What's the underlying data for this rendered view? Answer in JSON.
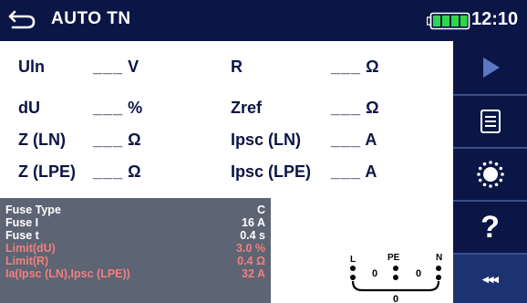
{
  "header": {
    "title": "AUTO TN",
    "time": "12:10",
    "back_icon": "back-arrow-icon",
    "battery_icon": "battery-icon"
  },
  "results": {
    "uln": {
      "label": "Uln",
      "value": "___",
      "unit": "V"
    },
    "du": {
      "label": "dU",
      "value": "___",
      "unit": "%"
    },
    "z_ln": {
      "label": "Z (LN)",
      "value": "___",
      "unit": "Ω"
    },
    "z_lpe": {
      "label": "Z (LPE)",
      "value": "___",
      "unit": "Ω"
    },
    "r": {
      "label": "R",
      "value": "___",
      "unit": "Ω"
    },
    "zref": {
      "label": "Zref",
      "value": "___",
      "unit": "Ω"
    },
    "ipsc_ln": {
      "label": "Ipsc (LN)",
      "value": "___",
      "unit": "A"
    },
    "ipsc_lpe": {
      "label": "Ipsc (LPE)",
      "value": "___",
      "unit": "A"
    }
  },
  "fuse": {
    "rows": [
      {
        "label": "Fuse Type",
        "value": "C",
        "style": "normal"
      },
      {
        "label": "Fuse I",
        "value": "16 A",
        "style": "normal"
      },
      {
        "label": "Fuse t",
        "value": "0.4 s",
        "style": "normal"
      },
      {
        "label": "Limit(dU)",
        "value": "3.0 %",
        "style": "limit"
      },
      {
        "label": "Limit(R)",
        "value": "0.4 Ω",
        "style": "limit"
      },
      {
        "label": "Ia(Ipsc (LN),Ipsc (LPE))",
        "value": "32 A",
        "style": "limit"
      }
    ]
  },
  "terminals": {
    "l_label": "L",
    "pe_label": "PE",
    "n_label": "N",
    "v1": "0",
    "v2": "0",
    "v3": "0"
  },
  "sidebar": {
    "buttons": [
      {
        "name": "start-button",
        "icon": "play-icon",
        "enabled": false
      },
      {
        "name": "parameters-button",
        "icon": "list-icon",
        "enabled": true
      },
      {
        "name": "calibration-button",
        "icon": "circle-dots-icon",
        "enabled": true
      },
      {
        "name": "help-button",
        "icon": "help-icon",
        "label": "?",
        "enabled": true
      },
      {
        "name": "more-button",
        "icon": "more-icon",
        "label": "◂◂◂",
        "enabled": true
      }
    ]
  },
  "colors": {
    "header_bg": "#0b1546",
    "accent": "#0b1546",
    "limit_text": "#f0807e",
    "fuse_bg": "#5d6474",
    "battery": "#2fd64a"
  }
}
